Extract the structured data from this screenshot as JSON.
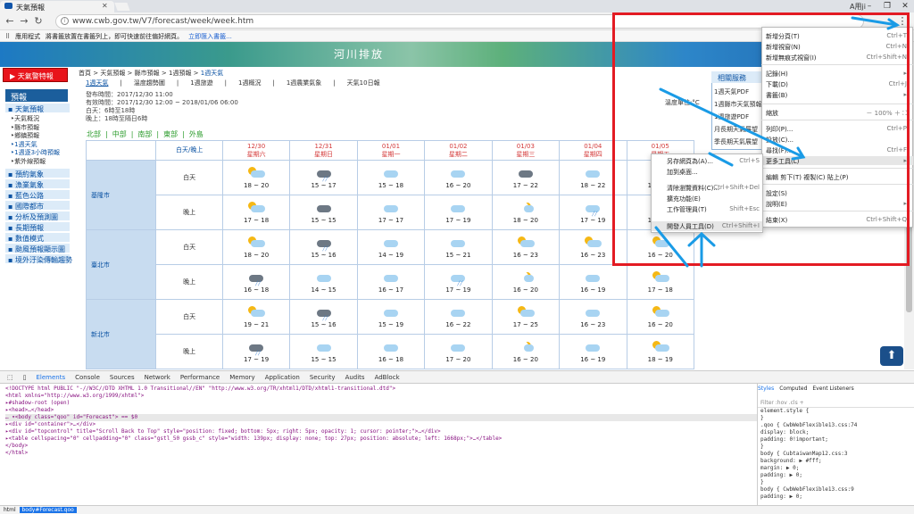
{
  "browser": {
    "tab_title": "天氣預報",
    "user_label": "A用ji",
    "url": "www.cwb.gov.tw/V7/forecast/week/week.htm",
    "bookmarks": {
      "apps": "應用程式",
      "hint": "將書籤放置在書籤列上，即可快速前往偏好網頁。",
      "import": "立即匯入書籤..."
    }
  },
  "site": {
    "banner_text": "河川排放",
    "quake_button": "天氣警特報",
    "forecast_header": "預報",
    "left_menu": [
      {
        "label": "天氣預報",
        "subs": [
          "天氣概況",
          "縣市預報",
          "鄉鎮預報",
          "1週天氣",
          "1週逐3小時預報",
          "紫外線預報"
        ]
      },
      {
        "label": "預約氣象"
      },
      {
        "label": "漁業氣象"
      },
      {
        "label": "藍色公路"
      },
      {
        "label": "國際都市"
      },
      {
        "label": "分析及預測圖"
      },
      {
        "label": "長期預報"
      },
      {
        "label": "數值模式"
      },
      {
        "label": "颱風預報顯示圖"
      },
      {
        "label": "境外汙染傳輸趨勢"
      }
    ],
    "breadcrumb": [
      "首頁",
      "天氣預報",
      "縣市預報",
      "1週預報",
      "1週天氣"
    ],
    "subnav": [
      "1週天氣",
      "溫度趨勢圖",
      "1週旅遊",
      "1週概況",
      "1週農業氣象",
      "天氣10日報"
    ],
    "info": {
      "issue": "發布時間：2017/12/30 11:00",
      "valid": "有效時間：2017/12/30 12:00 ~ 2018/01/06 06:00",
      "day": "白天：6時至18時",
      "night": "晚上：18時至隔日6時"
    },
    "regions": [
      "北部",
      "中部",
      "南部",
      "東部",
      "外島"
    ],
    "services": {
      "title": "相關服務",
      "items": [
        "1週天氣PDF",
        "1週縣市天氣預報PDF",
        "1週旅遊PDF",
        "月長期天氣展望",
        "季長期天氣展望"
      ]
    },
    "left_text": "溫度單位:°C"
  },
  "table": {
    "header_first": "白天/晚上",
    "dates": [
      {
        "date": "12/30",
        "weekday": "星期六"
      },
      {
        "date": "12/31",
        "weekday": "星期日"
      },
      {
        "date": "01/01",
        "weekday": "星期一"
      },
      {
        "date": "01/02",
        "weekday": "星期二"
      },
      {
        "date": "01/03",
        "weekday": "星期三"
      },
      {
        "date": "01/04",
        "weekday": "星期四"
      },
      {
        "date": "01/05",
        "weekday": "星期五"
      }
    ],
    "day_label": "白天",
    "night_label": "晚上",
    "cities": [
      {
        "name": "基隆市",
        "day": [
          [
            "sun-cloud",
            "18 ~ 20"
          ],
          [
            "dark-rain",
            "15 ~ 17"
          ],
          [
            "cloud",
            "15 ~ 18"
          ],
          [
            "cloud",
            "16 ~ 20"
          ],
          [
            "dark",
            "17 ~ 22"
          ],
          [
            "cloud",
            "18 ~ 22"
          ],
          [
            "cloud",
            "18 ~ 22"
          ]
        ],
        "night": [
          [
            "sun-cloud",
            "17 ~ 18"
          ],
          [
            "dark",
            "15 ~ 15"
          ],
          [
            "cloud",
            "17 ~ 17"
          ],
          [
            "cloud",
            "17 ~ 19"
          ],
          [
            "moon",
            "18 ~ 20"
          ],
          [
            "cloud-rain",
            "17 ~ 19"
          ],
          [
            "cloud",
            "17 ~ 19"
          ]
        ]
      },
      {
        "name": "臺北市",
        "day": [
          [
            "sun-cloud",
            "18 ~ 20"
          ],
          [
            "dark-rain",
            "15 ~ 16"
          ],
          [
            "cloud",
            "14 ~ 19"
          ],
          [
            "cloud",
            "15 ~ 21"
          ],
          [
            "sun-cloud",
            "16 ~ 23"
          ],
          [
            "sun-cloud",
            "16 ~ 23"
          ],
          [
            "sun-cloud",
            "16 ~ 20"
          ]
        ],
        "night": [
          [
            "dark-rain",
            "16 ~ 18"
          ],
          [
            "cloud",
            "14 ~ 15"
          ],
          [
            "cloud",
            "16 ~ 17"
          ],
          [
            "cloud-rain",
            "17 ~ 19"
          ],
          [
            "moon",
            "16 ~ 20"
          ],
          [
            "cloud",
            "16 ~ 19"
          ],
          [
            "sun-cloud",
            "17 ~ 18"
          ]
        ]
      },
      {
        "name": "新北市",
        "day": [
          [
            "sun-cloud",
            "19 ~ 21"
          ],
          [
            "dark-rain",
            "15 ~ 16"
          ],
          [
            "cloud",
            "15 ~ 19"
          ],
          [
            "cloud",
            "16 ~ 22"
          ],
          [
            "sun-cloud",
            "17 ~ 25"
          ],
          [
            "cloud",
            "16 ~ 23"
          ],
          [
            "sun-cloud",
            "16 ~ 20"
          ]
        ],
        "night": [
          [
            "dark-rain",
            "17 ~ 19"
          ],
          [
            "cloud",
            "15 ~ 15"
          ],
          [
            "cloud",
            "16 ~ 18"
          ],
          [
            "cloud",
            "17 ~ 20"
          ],
          [
            "moon",
            "16 ~ 20"
          ],
          [
            "cloud",
            "16 ~ 19"
          ],
          [
            "sun-cloud",
            "18 ~ 19"
          ]
        ]
      }
    ]
  },
  "chrome_menu": {
    "items": [
      {
        "label": "新增分頁(T)",
        "shortcut": "Ctrl+T"
      },
      {
        "label": "新增視窗(N)",
        "shortcut": "Ctrl+N"
      },
      {
        "label": "新增無痕式視窗(I)",
        "shortcut": "Ctrl+Shift+N"
      },
      {
        "label": "記錄(H)",
        "shortcut": "▸"
      },
      {
        "label": "下載(D)",
        "shortcut": "Ctrl+J"
      },
      {
        "label": "書籤(B)",
        "shortcut": "▸"
      },
      {
        "label": "縮放",
        "shortcut": "－   100%   ＋   ⛶"
      },
      {
        "label": "列印(P)...",
        "shortcut": "Ctrl+P"
      },
      {
        "label": "投放(C)...",
        "shortcut": ""
      },
      {
        "label": "尋找(F)...",
        "shortcut": "Ctrl+F"
      },
      {
        "label": "更多工具(L)",
        "shortcut": "▸"
      },
      {
        "label": "編輯     剪下(T)    複製(C)    貼上(P)",
        "shortcut": ""
      },
      {
        "label": "設定(S)",
        "shortcut": ""
      },
      {
        "label": "說明(E)",
        "shortcut": "▸"
      },
      {
        "label": "結束(X)",
        "shortcut": "Ctrl+Shift+Q"
      }
    ],
    "submenu": [
      {
        "label": "另存網頁為(A)...",
        "shortcut": "Ctrl+S"
      },
      {
        "label": "加到桌面...",
        "shortcut": ""
      },
      {
        "label": "清除瀏覽資料(C)...",
        "shortcut": "Ctrl+Shift+Del"
      },
      {
        "label": "擴充功能(E)",
        "shortcut": ""
      },
      {
        "label": "工作管理員(T)",
        "shortcut": "Shift+Esc"
      },
      {
        "label": "開發人員工具(D)",
        "shortcut": "Ctrl+Shift+I"
      }
    ]
  },
  "devtools": {
    "tabs": [
      "Elements",
      "Console",
      "Sources",
      "Network",
      "Performance",
      "Memory",
      "Application",
      "Security",
      "Audits",
      "AdBlock"
    ],
    "dom_lines": [
      "<!DOCTYPE html PUBLIC \"-//W3C//DTD XHTML 1.0 Transitional//EN\" \"http://www.w3.org/TR/xhtml1/DTD/xhtml1-transitional.dtd\">",
      "<html xmlns=\"http://www.w3.org/1999/xhtml\">",
      "  ▸#shadow-root (open)",
      "  ▸<head>…</head>",
      "… ▾<body class=\"qoo\" id=\"Forecast\"> == $0",
      "    ▸<div id=\"container\">…</div>",
      "    ▸<div id=\"topcontrol\" title=\"Scroll Back to Top\" style=\"position: fixed; bottom: 5px; right: 5px; opacity: 1; cursor: pointer;\">…</div>",
      "    ▸<table cellspacing=\"0\" cellpadding=\"0\" class=\"gstl_50 gssb_c\" style=\"width: 139px; display: none; top: 27px; position: absolute; left: 1668px;\">…</table>",
      "    </body>",
      "</html>"
    ],
    "style_tabs": [
      "Styles",
      "Computed",
      "Event Listeners"
    ],
    "filter_placeholder": "Filter",
    "style_lines": [
      "element.style {",
      "}",
      ".qoo {                     CwbWebFlexible13.css:74",
      "  display: block;",
      "  padding: 0!important;",
      "}",
      "body {                       CubtaiwanMap12.css:3",
      "  background: ▶ #fff;",
      "  margin: ▶ 0;",
      "  padding: ▶ 0;",
      "}",
      "body {                     CwbWebFlexible13.css:9",
      "  padding: ▶ 0;"
    ],
    "status": [
      "html",
      "body#Forecast.qoo"
    ]
  }
}
